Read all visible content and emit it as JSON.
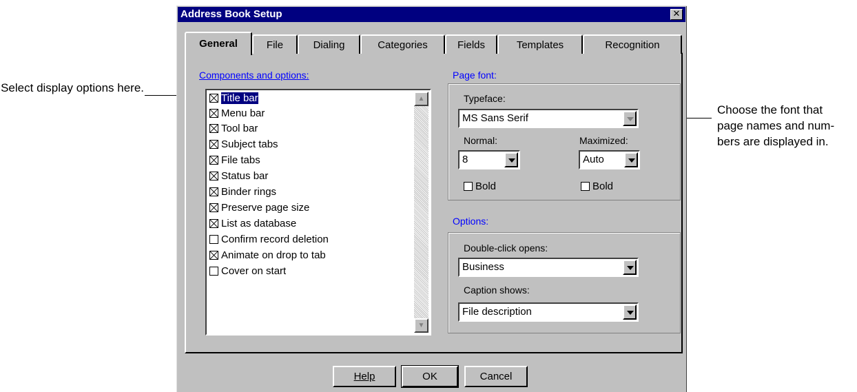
{
  "annotations": {
    "left": "Select display options here.",
    "right_lines": [
      "Choose the font that",
      "page names and num-",
      "bers are displayed in."
    ]
  },
  "dialog": {
    "title": "Address Book Setup",
    "close_glyph": "✕"
  },
  "tabs": [
    {
      "label": "General",
      "active": true
    },
    {
      "label": "File"
    },
    {
      "label": "Dialing"
    },
    {
      "label": "Categories"
    },
    {
      "label": "Fields"
    },
    {
      "label": "Templates"
    },
    {
      "label": "Recognition"
    }
  ],
  "components": {
    "label": "Components and options:",
    "items": [
      {
        "label": "Title bar",
        "checked": true,
        "selected": true
      },
      {
        "label": "Menu bar",
        "checked": true
      },
      {
        "label": "Tool bar",
        "checked": true
      },
      {
        "label": "Subject tabs",
        "checked": true
      },
      {
        "label": "File tabs",
        "checked": true
      },
      {
        "label": "Status bar",
        "checked": true
      },
      {
        "label": "Binder rings",
        "checked": true
      },
      {
        "label": "Preserve page size",
        "checked": true
      },
      {
        "label": "List as database",
        "checked": true
      },
      {
        "label": "Confirm record deletion",
        "checked": false
      },
      {
        "label": "Animate on drop to tab",
        "checked": true
      },
      {
        "label": "Cover on start",
        "checked": false
      }
    ]
  },
  "page_font": {
    "label": "Page font:",
    "typeface_label": "Typeface:",
    "typeface_value": "MS Sans Serif",
    "normal_label": "Normal:",
    "normal_value": "8",
    "maximized_label": "Maximized:",
    "maximized_value": "Auto",
    "bold_normal_label": "Bold",
    "bold_maximized_label": "Bold"
  },
  "options": {
    "label": "Options:",
    "double_click_label": "Double-click opens:",
    "double_click_value": "Business",
    "caption_label": "Caption shows:",
    "caption_value": "File description"
  },
  "buttons": {
    "help": "Help",
    "ok": "OK",
    "cancel": "Cancel"
  },
  "colors": {
    "titlebar": "#000080",
    "dialog_face": "#c0c0c0",
    "group_label": "#0000ff"
  }
}
